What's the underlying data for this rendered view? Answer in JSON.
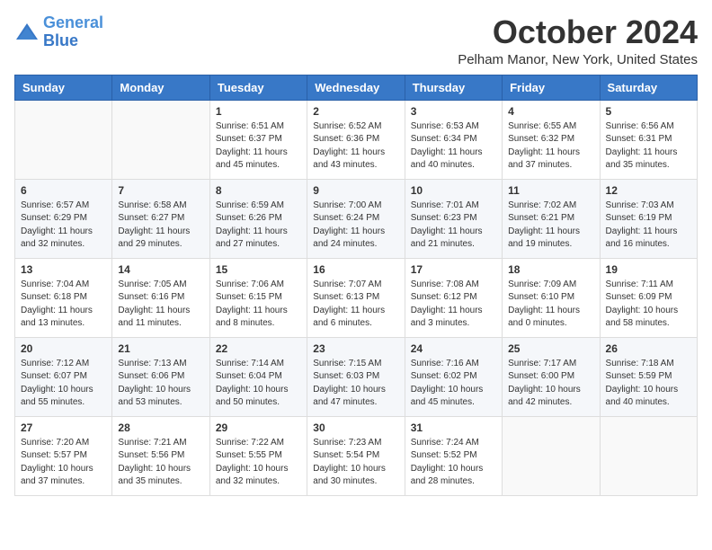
{
  "logo": {
    "line1": "General",
    "line2": "Blue"
  },
  "title": "October 2024",
  "location": "Pelham Manor, New York, United States",
  "days_of_week": [
    "Sunday",
    "Monday",
    "Tuesday",
    "Wednesday",
    "Thursday",
    "Friday",
    "Saturday"
  ],
  "weeks": [
    [
      {
        "day": "",
        "info": ""
      },
      {
        "day": "",
        "info": ""
      },
      {
        "day": "1",
        "info": "Sunrise: 6:51 AM\nSunset: 6:37 PM\nDaylight: 11 hours and 45 minutes."
      },
      {
        "day": "2",
        "info": "Sunrise: 6:52 AM\nSunset: 6:36 PM\nDaylight: 11 hours and 43 minutes."
      },
      {
        "day": "3",
        "info": "Sunrise: 6:53 AM\nSunset: 6:34 PM\nDaylight: 11 hours and 40 minutes."
      },
      {
        "day": "4",
        "info": "Sunrise: 6:55 AM\nSunset: 6:32 PM\nDaylight: 11 hours and 37 minutes."
      },
      {
        "day": "5",
        "info": "Sunrise: 6:56 AM\nSunset: 6:31 PM\nDaylight: 11 hours and 35 minutes."
      }
    ],
    [
      {
        "day": "6",
        "info": "Sunrise: 6:57 AM\nSunset: 6:29 PM\nDaylight: 11 hours and 32 minutes."
      },
      {
        "day": "7",
        "info": "Sunrise: 6:58 AM\nSunset: 6:27 PM\nDaylight: 11 hours and 29 minutes."
      },
      {
        "day": "8",
        "info": "Sunrise: 6:59 AM\nSunset: 6:26 PM\nDaylight: 11 hours and 27 minutes."
      },
      {
        "day": "9",
        "info": "Sunrise: 7:00 AM\nSunset: 6:24 PM\nDaylight: 11 hours and 24 minutes."
      },
      {
        "day": "10",
        "info": "Sunrise: 7:01 AM\nSunset: 6:23 PM\nDaylight: 11 hours and 21 minutes."
      },
      {
        "day": "11",
        "info": "Sunrise: 7:02 AM\nSunset: 6:21 PM\nDaylight: 11 hours and 19 minutes."
      },
      {
        "day": "12",
        "info": "Sunrise: 7:03 AM\nSunset: 6:19 PM\nDaylight: 11 hours and 16 minutes."
      }
    ],
    [
      {
        "day": "13",
        "info": "Sunrise: 7:04 AM\nSunset: 6:18 PM\nDaylight: 11 hours and 13 minutes."
      },
      {
        "day": "14",
        "info": "Sunrise: 7:05 AM\nSunset: 6:16 PM\nDaylight: 11 hours and 11 minutes."
      },
      {
        "day": "15",
        "info": "Sunrise: 7:06 AM\nSunset: 6:15 PM\nDaylight: 11 hours and 8 minutes."
      },
      {
        "day": "16",
        "info": "Sunrise: 7:07 AM\nSunset: 6:13 PM\nDaylight: 11 hours and 6 minutes."
      },
      {
        "day": "17",
        "info": "Sunrise: 7:08 AM\nSunset: 6:12 PM\nDaylight: 11 hours and 3 minutes."
      },
      {
        "day": "18",
        "info": "Sunrise: 7:09 AM\nSunset: 6:10 PM\nDaylight: 11 hours and 0 minutes."
      },
      {
        "day": "19",
        "info": "Sunrise: 7:11 AM\nSunset: 6:09 PM\nDaylight: 10 hours and 58 minutes."
      }
    ],
    [
      {
        "day": "20",
        "info": "Sunrise: 7:12 AM\nSunset: 6:07 PM\nDaylight: 10 hours and 55 minutes."
      },
      {
        "day": "21",
        "info": "Sunrise: 7:13 AM\nSunset: 6:06 PM\nDaylight: 10 hours and 53 minutes."
      },
      {
        "day": "22",
        "info": "Sunrise: 7:14 AM\nSunset: 6:04 PM\nDaylight: 10 hours and 50 minutes."
      },
      {
        "day": "23",
        "info": "Sunrise: 7:15 AM\nSunset: 6:03 PM\nDaylight: 10 hours and 47 minutes."
      },
      {
        "day": "24",
        "info": "Sunrise: 7:16 AM\nSunset: 6:02 PM\nDaylight: 10 hours and 45 minutes."
      },
      {
        "day": "25",
        "info": "Sunrise: 7:17 AM\nSunset: 6:00 PM\nDaylight: 10 hours and 42 minutes."
      },
      {
        "day": "26",
        "info": "Sunrise: 7:18 AM\nSunset: 5:59 PM\nDaylight: 10 hours and 40 minutes."
      }
    ],
    [
      {
        "day": "27",
        "info": "Sunrise: 7:20 AM\nSunset: 5:57 PM\nDaylight: 10 hours and 37 minutes."
      },
      {
        "day": "28",
        "info": "Sunrise: 7:21 AM\nSunset: 5:56 PM\nDaylight: 10 hours and 35 minutes."
      },
      {
        "day": "29",
        "info": "Sunrise: 7:22 AM\nSunset: 5:55 PM\nDaylight: 10 hours and 32 minutes."
      },
      {
        "day": "30",
        "info": "Sunrise: 7:23 AM\nSunset: 5:54 PM\nDaylight: 10 hours and 30 minutes."
      },
      {
        "day": "31",
        "info": "Sunrise: 7:24 AM\nSunset: 5:52 PM\nDaylight: 10 hours and 28 minutes."
      },
      {
        "day": "",
        "info": ""
      },
      {
        "day": "",
        "info": ""
      }
    ]
  ]
}
